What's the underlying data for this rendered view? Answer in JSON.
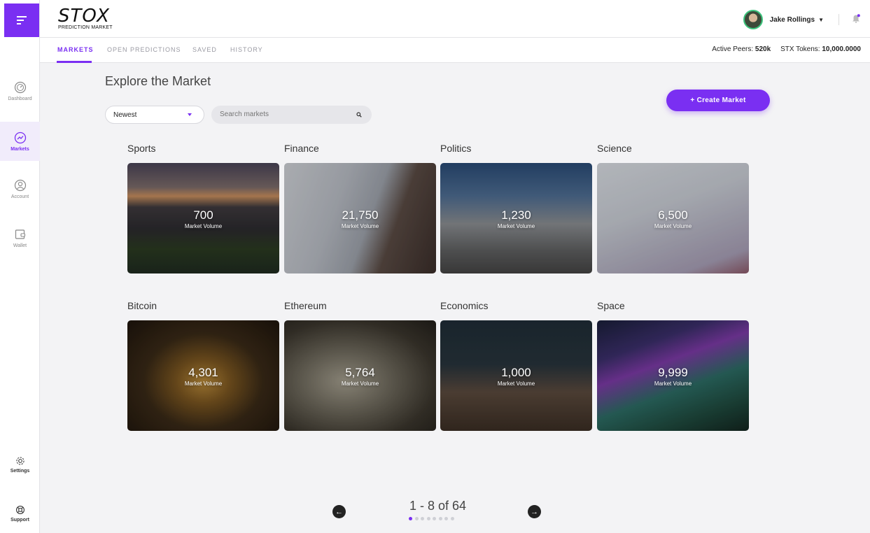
{
  "brand": {
    "logo_text": "STOX",
    "logo_sub": "PREDICTION MARKET",
    "accent": "#7a2ff2"
  },
  "sidebar": {
    "menu_icon": "menu-icon",
    "items": [
      {
        "label": "Dashboard",
        "icon": "gauge-icon"
      },
      {
        "label": "Markets",
        "icon": "trend-icon",
        "active": true
      },
      {
        "label": "Account",
        "icon": "account-icon"
      },
      {
        "label": "Wallet",
        "icon": "wallet-icon"
      }
    ],
    "bottom": [
      {
        "label": "Settings",
        "icon": "gear-icon"
      },
      {
        "label": "Support",
        "icon": "lifebuoy-icon"
      }
    ]
  },
  "header": {
    "user_name": "Jake Rollings",
    "stats": {
      "peers_label": "Active Peers:",
      "peers_value": "520k",
      "tokens_label": "STX Tokens:",
      "tokens_value": "10,000.0000"
    }
  },
  "tabs": [
    {
      "label": "MARKETS",
      "active": true
    },
    {
      "label": "OPEN PREDICTIONS"
    },
    {
      "label": "SAVED"
    },
    {
      "label": "HISTORY"
    }
  ],
  "main": {
    "title": "Explore the Market",
    "sort_value": "Newest",
    "search_placeholder": "Search markets",
    "create_label": "+ Create Market"
  },
  "markets": [
    {
      "name": "Sports",
      "volume": "700",
      "volume_label": "Market Volume"
    },
    {
      "name": "Finance",
      "volume": "21,750",
      "volume_label": "Market Volume"
    },
    {
      "name": "Politics",
      "volume": "1,230",
      "volume_label": "Market Volume"
    },
    {
      "name": "Science",
      "volume": "6,500",
      "volume_label": "Market Volume"
    },
    {
      "name": "Bitcoin",
      "volume": "4,301",
      "volume_label": "Market Volume"
    },
    {
      "name": "Ethereum",
      "volume": "5,764",
      "volume_label": "Market Volume"
    },
    {
      "name": "Economics",
      "volume": "1,000",
      "volume_label": "Market Volume"
    },
    {
      "name": "Space",
      "volume": "9,999",
      "volume_label": "Market Volume"
    }
  ],
  "pagination": {
    "text": "1 - 8 of 64",
    "pages": 8,
    "current": 1
  }
}
